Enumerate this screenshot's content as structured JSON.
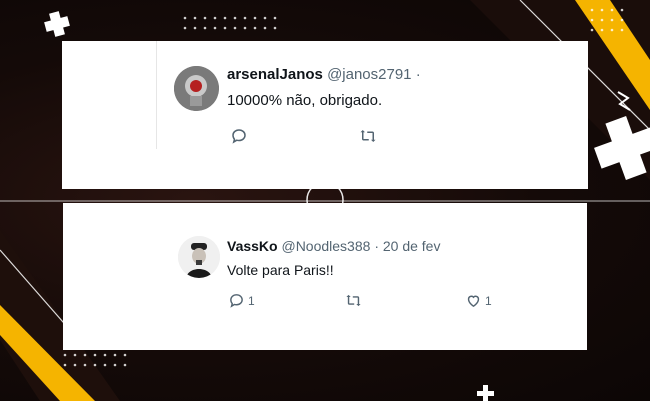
{
  "tweets": [
    {
      "display_name": "arsenalJanos",
      "handle": "@janos2791",
      "meta_suffix": "·",
      "text": "10000% não, obrigado."
    },
    {
      "display_name": "VassKo",
      "handle": "@Noodles388",
      "meta_suffix": "· 20 de fev",
      "text": "Volte para Paris!!",
      "reply_count": "1",
      "like_count": "1"
    }
  ],
  "colors": {
    "accent_yellow": "#f5b400",
    "text_primary": "#0f1419",
    "text_secondary": "#536471"
  },
  "icons": [
    "plus-icon",
    "reply-icon",
    "retweet-icon",
    "like-icon"
  ]
}
